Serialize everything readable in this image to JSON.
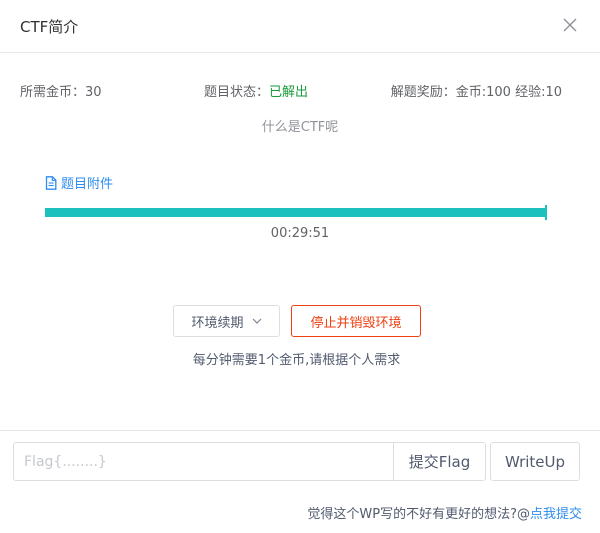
{
  "dialog": {
    "title": "CTF简介"
  },
  "info": {
    "coins_needed": "所需金币：30",
    "status_label": "题目状态：",
    "status_value": "已解出",
    "reward": "解题奖励：金币:100 经验:10"
  },
  "subtitle": "什么是CTF呢",
  "attachment": {
    "label": "题目附件",
    "icon": "file-icon"
  },
  "progress": {
    "percent": 100,
    "color": "#1ec0bd",
    "time_remaining": "00:29:51"
  },
  "environment": {
    "renew_label": "环境续期",
    "destroy_label": "停止并销毁环境",
    "note": "每分钟需要1个金币,请根据个人需求"
  },
  "flag": {
    "placeholder": "Flag{........}",
    "submit_label": "提交Flag",
    "writeup_label": "WriteUp"
  },
  "bottom": {
    "text": "觉得这个WP写的不好有更好的想法?@",
    "link": "点我提交"
  },
  "colors": {
    "accent": "#2d8cf0",
    "solved": "#1a9a3a",
    "danger": "#ed4014",
    "progress": "#1ec0bd"
  }
}
